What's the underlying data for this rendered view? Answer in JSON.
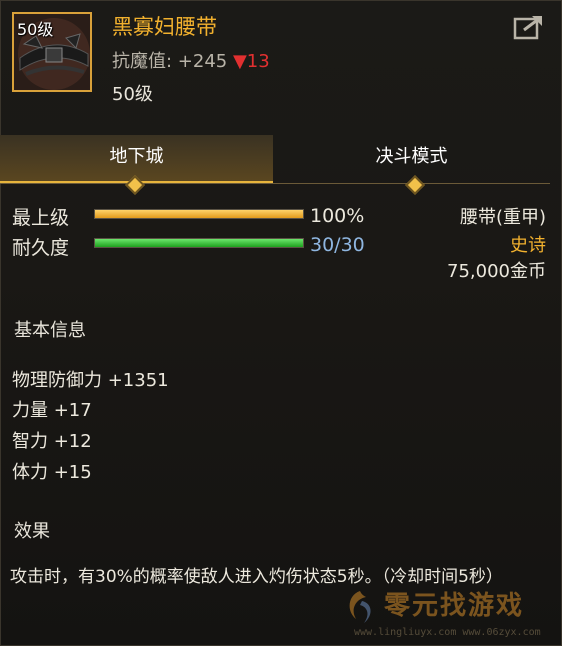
{
  "item": {
    "level_badge": "50级",
    "name": "黑寡妇腰带",
    "resist_label": "抗魔值: +245",
    "resist_change": "▼13",
    "required_level": "50级"
  },
  "tabs": [
    {
      "label": "地下城",
      "active": true
    },
    {
      "label": "决斗模式",
      "active": false
    }
  ],
  "stats": {
    "max_level_label": "最上级",
    "max_level_value": "100%",
    "max_level_fraction": 1.0,
    "durability_label": "耐久度",
    "durability_value": "30/30",
    "durability_fraction": 1.0
  },
  "info": {
    "type": "腰带(重甲)",
    "rarity": "史诗",
    "price": "75,000金币"
  },
  "basic": {
    "title": "基本信息",
    "attrs": [
      "物理防御力 +1351",
      "力量 +17",
      "智力 +12",
      "体力 +15"
    ]
  },
  "effect": {
    "title": "效果",
    "text": "攻击时，有30%的概率使敌人进入灼伤状态5秒。（冷却时间5秒）"
  },
  "watermark": {
    "title": "零元找游戏",
    "url": "www.lingliuyx.com  www.06zyx.com"
  },
  "colors": {
    "name": "#f2b12e",
    "rarity": "#f2b12e",
    "durability": "#8fb6e0",
    "resist_down": "#e23030"
  }
}
